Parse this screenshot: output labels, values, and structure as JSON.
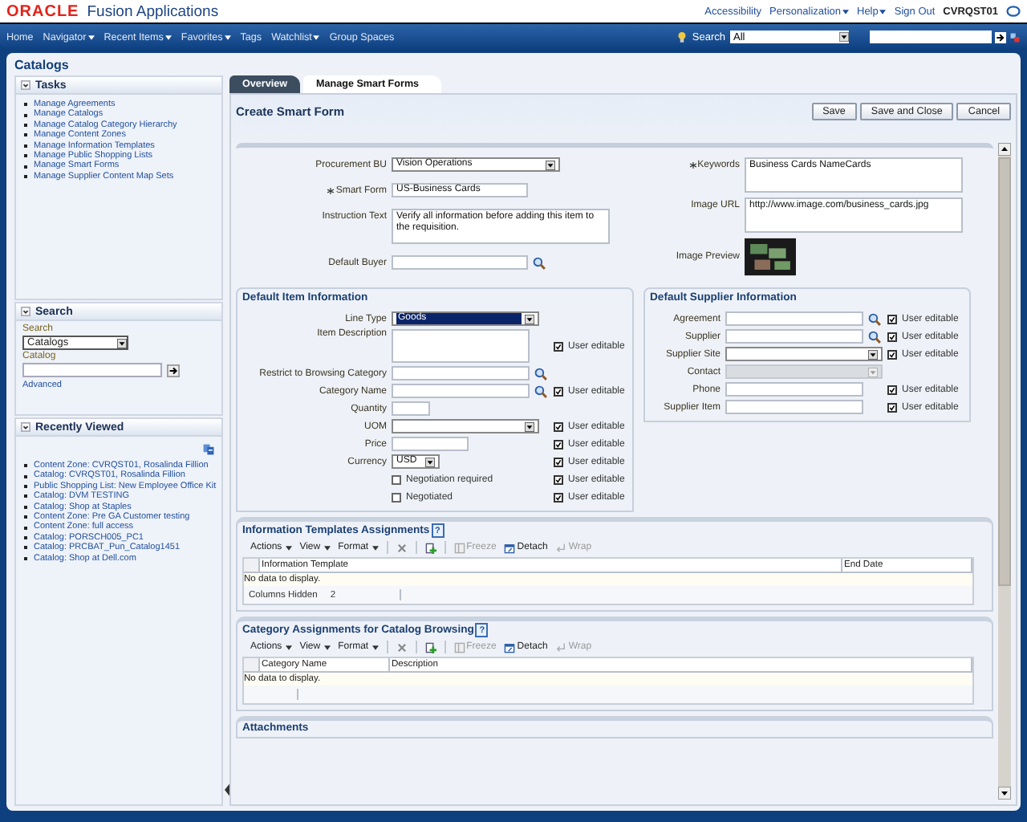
{
  "header": {
    "brand": "ORACLE",
    "product": "Fusion Applications",
    "links": [
      {
        "label": "Accessibility",
        "menu": false
      },
      {
        "label": "Personalization",
        "menu": true
      },
      {
        "label": "Help",
        "menu": true
      },
      {
        "label": "Sign Out",
        "menu": false
      }
    ],
    "user": "CVRQST01"
  },
  "nav": {
    "items": [
      {
        "label": "Home",
        "menu": false
      },
      {
        "label": "Navigator",
        "menu": true
      },
      {
        "label": "Recent Items",
        "menu": true
      },
      {
        "label": "Favorites",
        "menu": true
      },
      {
        "label": "Tags",
        "menu": false
      },
      {
        "label": "Watchlist",
        "menu": true
      },
      {
        "label": "Group Spaces",
        "menu": false
      }
    ],
    "search_label": "Search",
    "search_scope": "All"
  },
  "page_title": "Catalogs",
  "tasks": {
    "title": "Tasks",
    "items": [
      "Manage Agreements",
      "Manage Catalogs",
      "Manage Catalog Category Hierarchy",
      "Manage Content Zones",
      "Manage Information Templates",
      "Manage Public Shopping Lists",
      "Manage Smart Forms",
      "Manage Supplier Content Map Sets"
    ]
  },
  "search_panel": {
    "title": "Search",
    "search_label": "Search",
    "search_value": "Catalogs",
    "catalog_label": "Catalog",
    "advanced": "Advanced"
  },
  "recent": {
    "title": "Recently Viewed",
    "items": [
      "Content Zone: CVRQST01, Rosalinda Fillion",
      "Catalog: CVRQST01, Rosalinda Fillion",
      "Public Shopping List: New Employee Office Kit",
      "Catalog: DVM TESTING",
      "Catalog: Shop at Staples",
      "Content Zone: Pre GA Customer testing",
      "Content Zone: full access",
      "Catalog: PORSCH005_PC1",
      "Catalog: PRCBAT_Pun_Catalog1451",
      "Catalog: Shop at Dell.com"
    ]
  },
  "tabs": [
    {
      "label": "Overview",
      "selected": false
    },
    {
      "label": "Manage Smart Forms",
      "selected": true
    }
  ],
  "form": {
    "title": "Create Smart Form",
    "buttons": [
      "Save",
      "Save and Close",
      "Cancel"
    ],
    "left_fields": [
      {
        "kind": "select",
        "label": "Procurement BU",
        "required": false,
        "value": "Vision Operations"
      },
      {
        "kind": "text",
        "label": "Smart Form",
        "required": true,
        "value": "US-Business Cards"
      },
      {
        "kind": "textarea",
        "label": "Instruction Text",
        "required": false,
        "value": "Verify all information before adding this item to the requisition."
      },
      {
        "kind": "lookup",
        "label": "Default Buyer",
        "required": false
      }
    ],
    "right_fields": [
      {
        "kind": "textarea",
        "label": "Keywords",
        "required": true,
        "value": "Business Cards NameCards"
      },
      {
        "kind": "textarea",
        "label": "Image URL",
        "required": false,
        "value": "http://www.image.com/business_cards.jpg"
      },
      {
        "kind": "image",
        "label": "Image Preview",
        "required": false
      }
    ]
  },
  "item_info": {
    "title": "Default Item Information",
    "fields": [
      {
        "kind": "select-focused",
        "label": "Line Type",
        "value": "Goods"
      },
      {
        "kind": "textarea",
        "label": "Item Description",
        "user_editable": {
          "label": "User editable",
          "checked": true
        }
      },
      {
        "kind": "lookup",
        "label": "Restrict to Browsing Category"
      },
      {
        "kind": "lookup",
        "label": "Category Name",
        "user_editable": {
          "label": "User editable",
          "checked": true
        }
      },
      {
        "kind": "text-short",
        "label": "Quantity"
      },
      {
        "kind": "select",
        "label": "UOM",
        "user_editable": {
          "label": "User editable",
          "checked": true
        }
      },
      {
        "kind": "text-medium",
        "label": "Price",
        "user_editable": {
          "label": "User editable",
          "checked": true
        }
      },
      {
        "kind": "select-small",
        "label": "Currency",
        "value": "USD",
        "user_editable": {
          "label": "User editable",
          "checked": true
        }
      },
      {
        "kind": "checkbox",
        "label": "Negotiation required",
        "checked": false,
        "user_editable": {
          "label": "User editable",
          "checked": true
        }
      },
      {
        "kind": "checkbox",
        "label": "Negotiated",
        "checked": false,
        "user_editable": {
          "label": "User editable",
          "checked": true
        }
      }
    ]
  },
  "supplier_info": {
    "title": "Default Supplier Information",
    "fields": [
      {
        "kind": "lookup",
        "label": "Agreement",
        "user_editable": {
          "label": "User editable",
          "checked": true
        }
      },
      {
        "kind": "lookup",
        "label": "Supplier",
        "user_editable": {
          "label": "User editable",
          "checked": true
        }
      },
      {
        "kind": "select",
        "label": "Supplier Site",
        "user_editable": {
          "label": "User editable",
          "checked": true
        }
      },
      {
        "kind": "select-disabled",
        "label": "Contact"
      },
      {
        "kind": "text",
        "label": "Phone",
        "user_editable": {
          "label": "User editable",
          "checked": true
        }
      },
      {
        "kind": "text",
        "label": "Supplier Item",
        "user_editable": {
          "label": "User editable",
          "checked": true
        }
      }
    ]
  },
  "tables": [
    {
      "title": "Information Templates Assignments",
      "help": "?",
      "menus": [
        "Actions",
        "View",
        "Format"
      ],
      "tools": [
        {
          "kind": "freeze",
          "label": "Freeze",
          "disabled": true
        },
        {
          "kind": "detach",
          "label": "Detach",
          "disabled": false
        },
        {
          "kind": "wrap",
          "label": "Wrap",
          "disabled": true
        }
      ],
      "columns": [
        {
          "label": "Information Template",
          "wide": true
        },
        {
          "label": "End Date",
          "wide": false
        }
      ],
      "empty": "No data to display.",
      "footer": {
        "label": "Columns Hidden",
        "value": "2"
      }
    },
    {
      "title": "Category Assignments for Catalog Browsing",
      "help": "?",
      "menus": [
        "Actions",
        "View",
        "Format"
      ],
      "tools": [
        {
          "kind": "freeze",
          "label": "Freeze",
          "disabled": true
        },
        {
          "kind": "detach",
          "label": "Detach",
          "disabled": false
        },
        {
          "kind": "wrap",
          "label": "Wrap",
          "disabled": true
        }
      ],
      "columns": [
        {
          "label": "Category Name",
          "wide": false
        },
        {
          "label": "Description",
          "wide": true
        }
      ],
      "empty": "No data to display."
    }
  ],
  "attachments": {
    "title": "Attachments"
  }
}
